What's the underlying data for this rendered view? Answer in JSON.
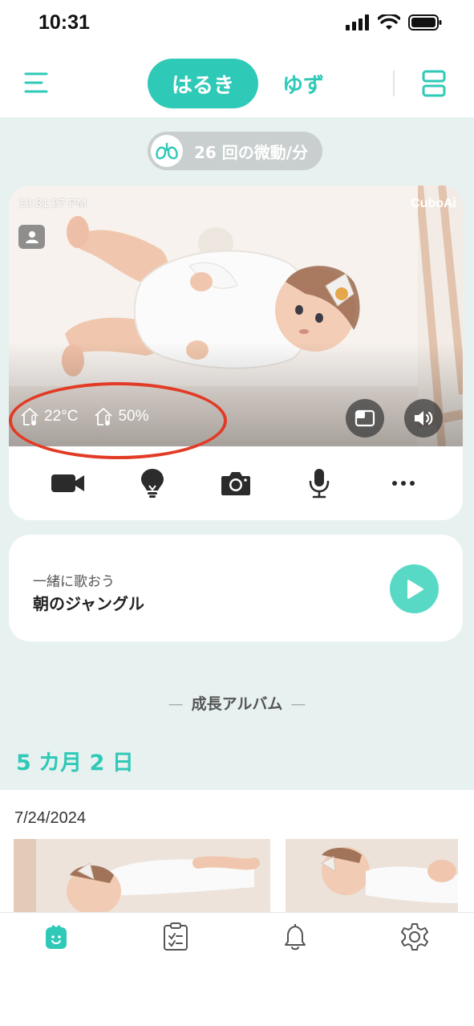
{
  "status_bar": {
    "time": "10:31"
  },
  "header": {
    "baby_tabs": [
      {
        "label": "はるき",
        "active": true
      },
      {
        "label": "ゆず",
        "active": false
      }
    ],
    "icons": {
      "menu": "menu-icon",
      "layout": "layout-icon"
    }
  },
  "breathing": {
    "text": "26 回の微動/分",
    "icon": "lungs-icon"
  },
  "camera": {
    "timestamp": "10:31:27 PM",
    "brand": "CuboAi",
    "temperature": "22°C",
    "humidity": "50%",
    "controls": [
      {
        "name": "video-record",
        "icon": "video-camera-icon"
      },
      {
        "name": "night-light",
        "icon": "lightbulb-icon"
      },
      {
        "name": "snapshot",
        "icon": "camera-icon"
      },
      {
        "name": "talk",
        "icon": "microphone-icon"
      },
      {
        "name": "more",
        "icon": "more-icon"
      }
    ]
  },
  "song": {
    "subtitle": "一緒に歌おう",
    "title": "朝のジャングル"
  },
  "album": {
    "section_title": "成長アルバム",
    "age": "5 カ月 2 日",
    "entry_date": "7/24/2024"
  },
  "colors": {
    "accent": "#2fc9b7",
    "background": "#e7f1f0",
    "highlight_ring": "#e23a25"
  },
  "tab_bar": [
    {
      "name": "home",
      "icon": "home-face-icon",
      "active": true
    },
    {
      "name": "diary",
      "icon": "clipboard-icon",
      "active": false
    },
    {
      "name": "notifications",
      "icon": "bell-icon",
      "active": false
    },
    {
      "name": "settings",
      "icon": "gear-icon",
      "active": false
    }
  ]
}
